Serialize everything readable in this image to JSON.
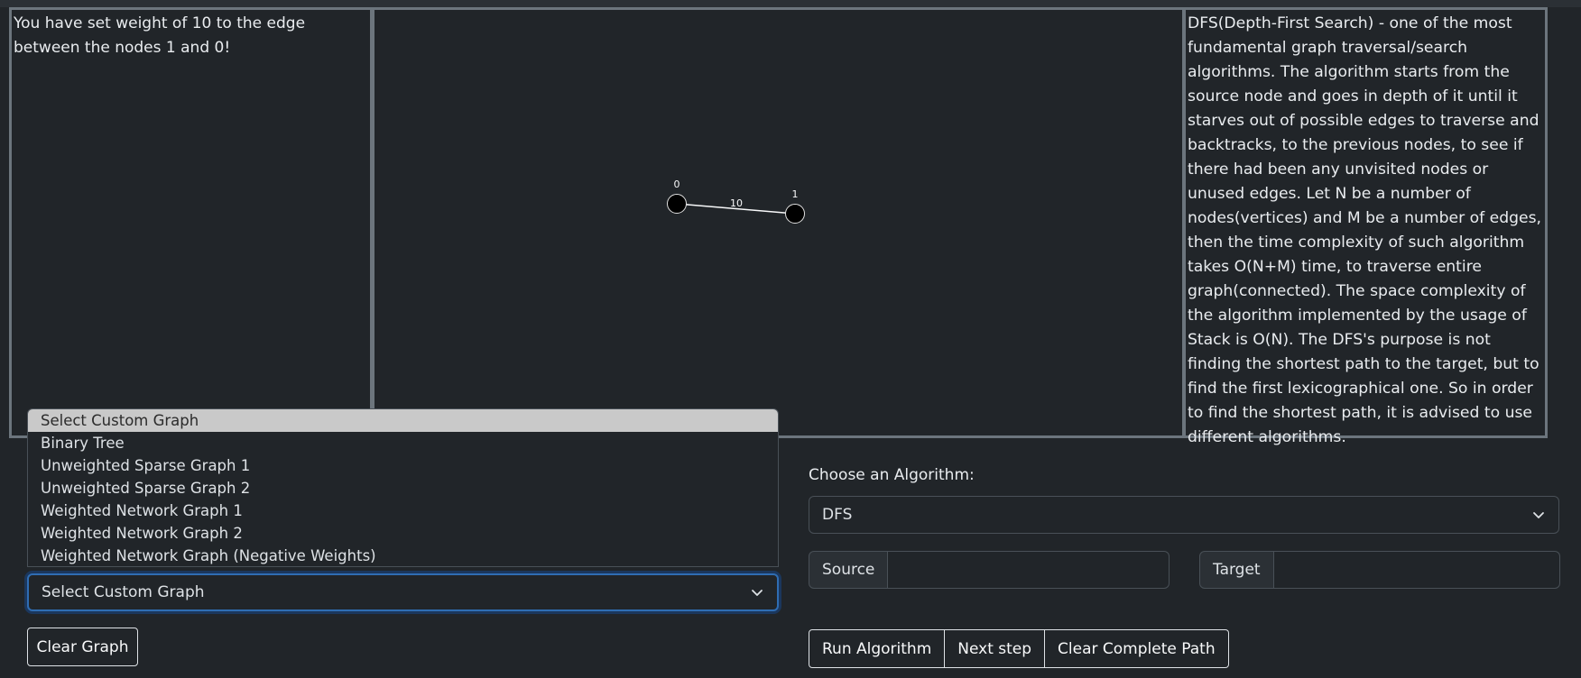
{
  "log": {
    "message": "You have set weight of 10 to the edge between the nodes 1 and 0!"
  },
  "graph": {
    "nodes": [
      {
        "id": "0",
        "label": "0"
      },
      {
        "id": "1",
        "label": "1"
      }
    ],
    "edges": [
      {
        "from": "0",
        "to": "1",
        "weight": "10"
      }
    ]
  },
  "info": {
    "text": "DFS(Depth-First Search) - one of the most fundamental graph traversal/search algorithms. The algorithm starts from the source node and goes in depth of it until it starves out of possible edges to traverse and backtracks, to the previous nodes, to see if there had been any unvisited nodes or unused edges. Let N be a number of nodes(vertices) and M be a number of edges, then the time complexity of such algorithm takes O(N+M) time, to traverse entire graph(connected). The space complexity of the algorithm implemented by the usage of Stack is O(N). The DFS's purpose is not finding the shortest path to the target, but to find the first lexicographical one. So in order to find the shortest path, it is advised to use different algorithms."
  },
  "custom_graph": {
    "selected": "Select Custom Graph",
    "options": [
      "Select Custom Graph",
      "Binary Tree",
      "Unweighted Sparse Graph 1",
      "Unweighted Sparse Graph 2",
      "Weighted Network Graph 1",
      "Weighted Network Graph 2",
      "Weighted Network Graph (Negative Weights)"
    ]
  },
  "buttons": {
    "clear_graph": "Clear Graph",
    "run_algorithm": "Run Algorithm",
    "next_step": "Next step",
    "clear_complete_path": "Clear Complete Path"
  },
  "algorithm": {
    "label": "Choose an Algorithm:",
    "selected": "DFS",
    "source_label": "Source",
    "source_value": "",
    "target_label": "Target",
    "target_value": ""
  },
  "icons": {
    "dropdown": "chevron-down-icon"
  },
  "colors": {
    "background": "#212529",
    "panel_border": "#6c757d",
    "focus": "#2f6db3"
  }
}
